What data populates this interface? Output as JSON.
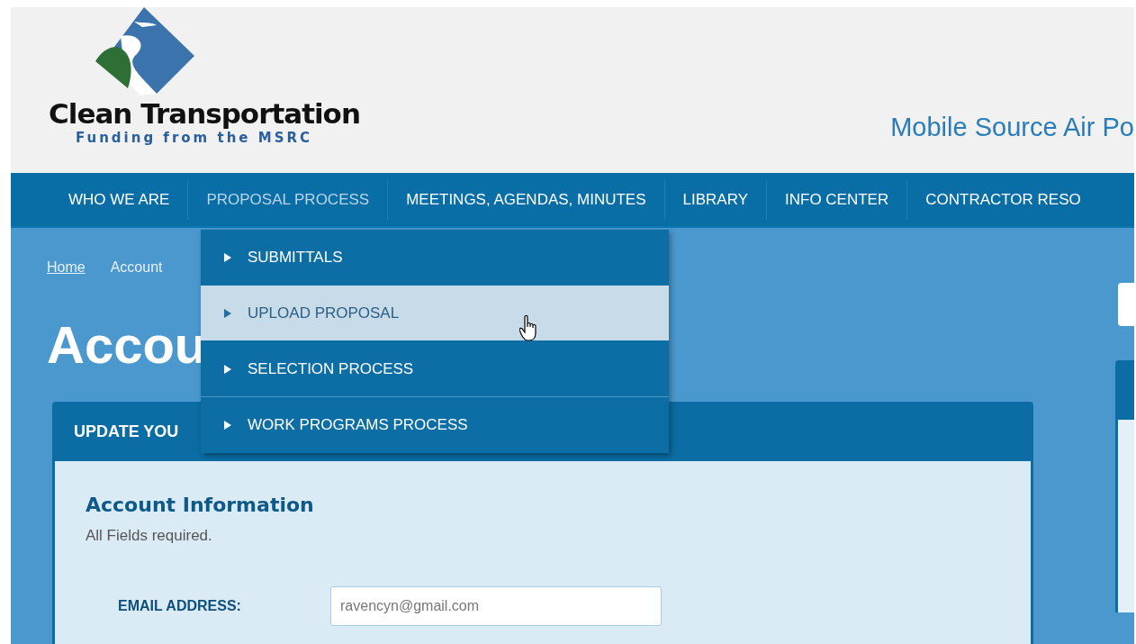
{
  "header": {
    "logo_title": "Clean Transportation",
    "logo_subtitle": "Funding from the MSRC",
    "tagline": "Mobile Source Air Po"
  },
  "nav": [
    {
      "label": "WHO WE ARE",
      "selected": false
    },
    {
      "label": "PROPOSAL PROCESS",
      "selected": true
    },
    {
      "label": "MEETINGS, AGENDAS, MINUTES",
      "selected": false
    },
    {
      "label": "LIBRARY",
      "selected": false
    },
    {
      "label": "INFO CENTER",
      "selected": false
    },
    {
      "label": "CONTRACTOR RESO",
      "selected": false
    }
  ],
  "dropdown": [
    {
      "label": "SUBMITTALS",
      "selected": false
    },
    {
      "label": "UPLOAD PROPOSAL",
      "selected": true
    },
    {
      "label": "SELECTION PROCESS",
      "selected": false
    },
    {
      "label": "WORK PROGRAMS PROCESS",
      "selected": false
    }
  ],
  "breadcrumb": [
    {
      "label": "Home",
      "kind": "link"
    },
    {
      "label": "Account",
      "kind": "current"
    }
  ],
  "page_title": "Accou",
  "panel": {
    "title": "UPDATE YOU",
    "section_title": "Account Information",
    "note": "All Fields required.",
    "fields": [
      {
        "label": "EMAIL ADDRESS:",
        "value": "ravencyn@gmail.com"
      }
    ]
  }
}
